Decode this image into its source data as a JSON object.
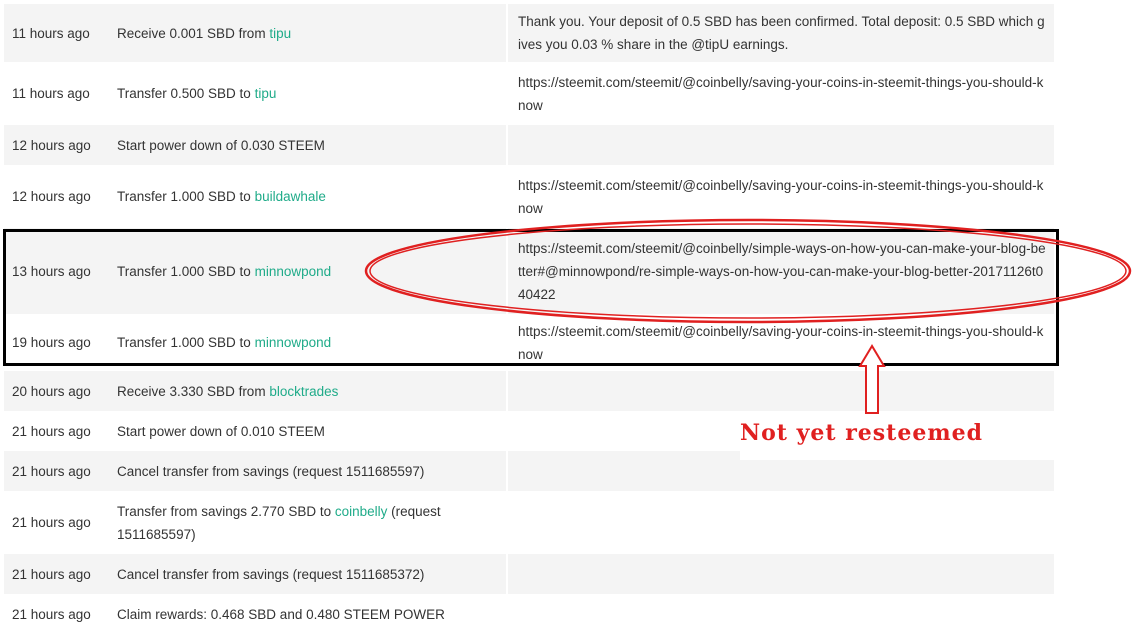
{
  "transactions": [
    {
      "time": "11 hours ago",
      "op_text": "Receive 0.001 SBD from ",
      "op_link": "tipu",
      "op_tail": "",
      "memo": "Thank you. Your deposit of 0.5 SBD has been confirmed. Total deposit: 0.5 SBD which gives you 0.03 % share in the @tipU earnings."
    },
    {
      "time": "11 hours ago",
      "op_text": "Transfer 0.500 SBD to ",
      "op_link": "tipu",
      "op_tail": "",
      "memo": "https://steemit.com/steemit/@coinbelly/saving-your-coins-in-steemit-things-you-should-know"
    },
    {
      "time": "12 hours ago",
      "op_text": "Start power down of 0.030 STEEM",
      "op_link": "",
      "op_tail": "",
      "memo": ""
    },
    {
      "time": "12 hours ago",
      "op_text": "Transfer 1.000 SBD to ",
      "op_link": "buildawhale",
      "op_tail": "",
      "memo": "https://steemit.com/steemit/@coinbelly/saving-your-coins-in-steemit-things-you-should-know"
    },
    {
      "time": "13 hours ago",
      "op_text": "Transfer 1.000 SBD to ",
      "op_link": "minnowpond",
      "op_tail": "",
      "memo": "https://steemit.com/steemit/@coinbelly/simple-ways-on-how-you-can-make-your-blog-better#@minnowpond/re-simple-ways-on-how-you-can-make-your-blog-better-20171126t040422"
    },
    {
      "time": "19 hours ago",
      "op_text": "Transfer 1.000 SBD to ",
      "op_link": "minnowpond",
      "op_tail": "",
      "memo": "https://steemit.com/steemit/@coinbelly/saving-your-coins-in-steemit-things-you-should-know"
    },
    {
      "time": "20 hours ago",
      "op_text": "Receive 3.330 SBD from ",
      "op_link": "blocktrades",
      "op_tail": "",
      "memo": ""
    },
    {
      "time": "21 hours ago",
      "op_text": "Start power down of 0.010 STEEM",
      "op_link": "",
      "op_tail": "",
      "memo": ""
    },
    {
      "time": "21 hours ago",
      "op_text": "Cancel transfer from savings (request 1511685597)",
      "op_link": "",
      "op_tail": "",
      "memo": ""
    },
    {
      "time": "21 hours ago",
      "op_text": "Transfer from savings 2.770 SBD to ",
      "op_link": "coinbelly",
      "op_tail": " (request 1511685597)",
      "memo": ""
    },
    {
      "time": "21 hours ago",
      "op_text": "Cancel transfer from savings (request 1511685372)",
      "op_link": "",
      "op_tail": "",
      "memo": ""
    },
    {
      "time": "21 hours ago",
      "op_text": "Claim rewards: 0.468 SBD and 0.480 STEEM POWER",
      "op_link": "",
      "op_tail": "",
      "memo": ""
    }
  ],
  "annotation": {
    "note": "Not yet resteemed",
    "color": "#e02020",
    "box_color": "#000000"
  },
  "colors": {
    "link": "#1fab89",
    "row_shade": "#f4f4f4",
    "text": "#333333"
  }
}
